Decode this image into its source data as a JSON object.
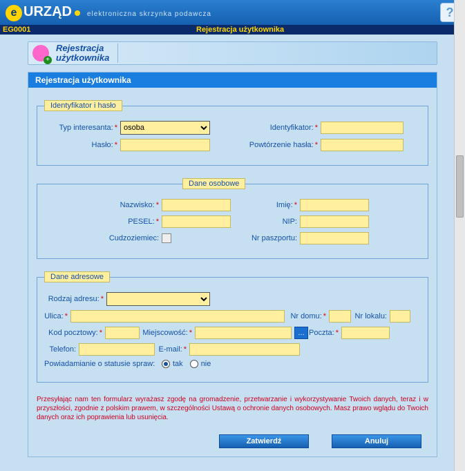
{
  "header": {
    "logo_main": "URZĄD",
    "logo_tag": "elektroniczna skrzynka podawcza"
  },
  "subheader": {
    "code": "EG0001",
    "title": "Rejestracja użytkownika"
  },
  "titlebar": {
    "line1": "Rejestracja",
    "line2": "użytkownika"
  },
  "panel": {
    "heading": "Rejestracja użytkownika"
  },
  "fs1": {
    "legend": "Identyfikator i hasło",
    "type_label": "Typ interesanta:",
    "type_value": "osoba",
    "ident_label": "Identyfikator:",
    "pass_label": "Hasło:",
    "pass2_label": "Powtórzenie hasła:"
  },
  "fs2": {
    "legend": "Dane osobowe",
    "nazw": "Nazwisko:",
    "imie": "Imię:",
    "pesel": "PESEL:",
    "nip": "NIP:",
    "cudz": "Cudzoziemiec:",
    "pasz": "Nr paszportu:"
  },
  "fs3": {
    "legend": "Dane adresowe",
    "rodzaj": "Rodzaj adresu:",
    "ulica": "Ulica:",
    "nrdomu": "Nr domu:",
    "nrlok": "Nr lokalu:",
    "kod": "Kod pocztowy:",
    "miejsc": "Miejscowość:",
    "poczta": "Poczta:",
    "tel": "Telefon:",
    "email": "E-mail:",
    "notify": "Powiadamianie o statusie spraw:",
    "opt_yes": "tak",
    "opt_no": "nie",
    "notify_value": "tak"
  },
  "consent": "Przesyłając nam ten formularz wyrażasz zgodę na gromadzenie, przetwarzanie i wykorzystywanie Twoich danych, teraz i w przyszłości, zgodnie z polskim prawem, w szczególności Ustawą o ochronie danych osobowych. Masz prawo wglądu do Twoich danych oraz ich poprawienia lub usunięcia.",
  "buttons": {
    "confirm": "Zatwierdź",
    "cancel": "Anuluj"
  }
}
